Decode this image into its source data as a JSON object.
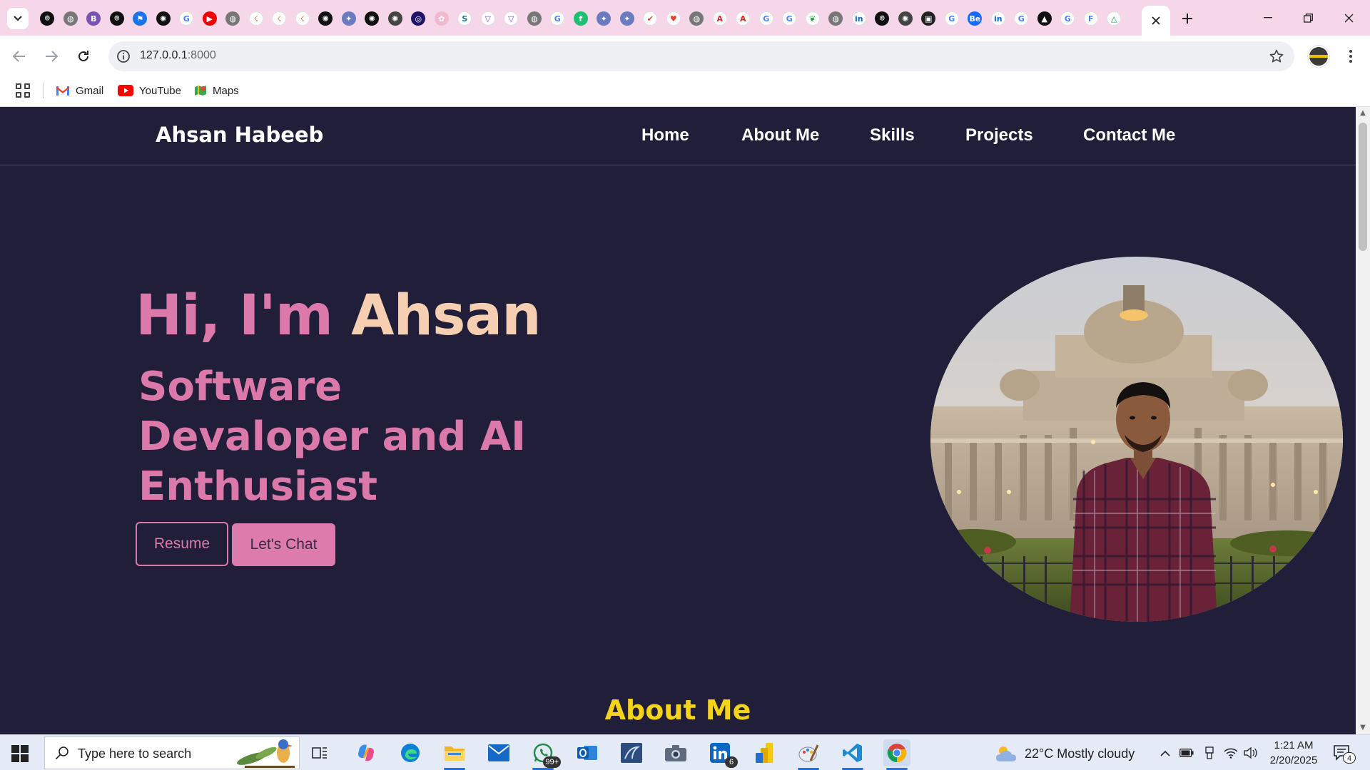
{
  "browser": {
    "url_host": "127.0.0.1",
    "url_port": ":8000",
    "tab_favicons": [
      "github-icon",
      "globe-icon",
      "bootstrap-icon",
      "github-icon",
      "flag-icon",
      "openai-icon",
      "google-icon",
      "youtube-icon",
      "globe-icon",
      "claude-icon",
      "claude-icon",
      "claude-icon",
      "openai-icon",
      "copilot-icon",
      "openai-icon",
      "chatgpt-icon",
      "lens-icon",
      "stars-icon",
      "scribd-icon",
      "proton-icon",
      "proton-icon",
      "globe-icon",
      "google-icon",
      "fiverr-icon",
      "copilot-icon",
      "copilot-icon",
      "todoist-icon",
      "heart-icon",
      "globe-icon",
      "adobe-icon",
      "adobe-icon",
      "google-icon",
      "google-icon",
      "leaf-icon",
      "globe-icon",
      "linkedin-icon",
      "github-icon",
      "chatgpt-icon",
      "photo-icon",
      "google-icon",
      "behance-icon",
      "linkedin-icon",
      "google-icon",
      "vercel-icon",
      "google-icon",
      "forms-icon",
      "drive-icon"
    ]
  },
  "bookmarks": [
    {
      "label": "Gmail",
      "icon": "gmail-icon"
    },
    {
      "label": "YouTube",
      "icon": "youtube-icon"
    },
    {
      "label": "Maps",
      "icon": "maps-icon"
    }
  ],
  "site": {
    "brand": "Ahsan Habeeb",
    "nav": [
      "Home",
      "About Me",
      "Skills",
      "Projects",
      "Contact Me"
    ],
    "hero": {
      "greeting": "Hi, I'm ",
      "name": "Ahsan",
      "subtitle": "Software Devaloper and AI Enthusiast",
      "resume_label": "Resume",
      "chat_label": "Let's Chat"
    },
    "about_heading": "About Me",
    "colors": {
      "background": "#201e38",
      "accent_pink": "#db7aaa",
      "accent_peach": "#f6ceb1",
      "accent_yellow": "#f5d31b"
    }
  },
  "taskbar": {
    "search_placeholder": "Type here to search",
    "whatsapp_badge": "99+",
    "linkedin_badge": "6",
    "weather": "22°C  Mostly cloudy",
    "time": "1:21 AM",
    "date": "2/20/2025",
    "notification_count": "4"
  }
}
